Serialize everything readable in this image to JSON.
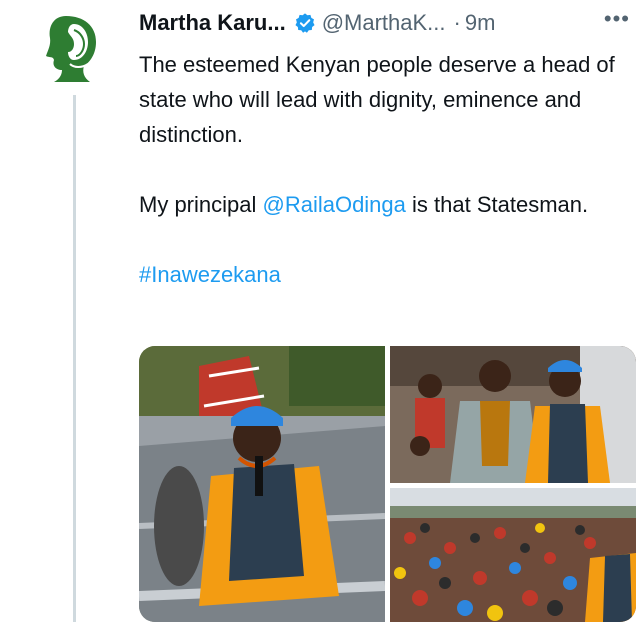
{
  "tweet": {
    "author": {
      "display_name": "Martha Karu...",
      "handle": "@MarthaK...",
      "verified": true,
      "avatar_icon": "portrait-logo-icon",
      "avatar_color": "#2e7d32"
    },
    "separator": "·",
    "timestamp": "9m",
    "more_icon": "more-dots-icon",
    "more_label": "•••",
    "text": {
      "line1": "The esteemed Kenyan people deserve a head of state who will lead with dignity, eminence and distinction.",
      "line2_prefix": "My principal ",
      "mention": "@RailaOdinga",
      "line2_suffix": " is that Statesman.",
      "hashtag": "#Inawezekana"
    },
    "media": [
      {
        "name": "photo-rally-speaker"
      },
      {
        "name": "photo-group-standing"
      },
      {
        "name": "photo-crowd"
      }
    ]
  },
  "colors": {
    "link": "#1d9bf0",
    "secondary_text": "#536471",
    "verified_badge": "#1d9bf0"
  }
}
